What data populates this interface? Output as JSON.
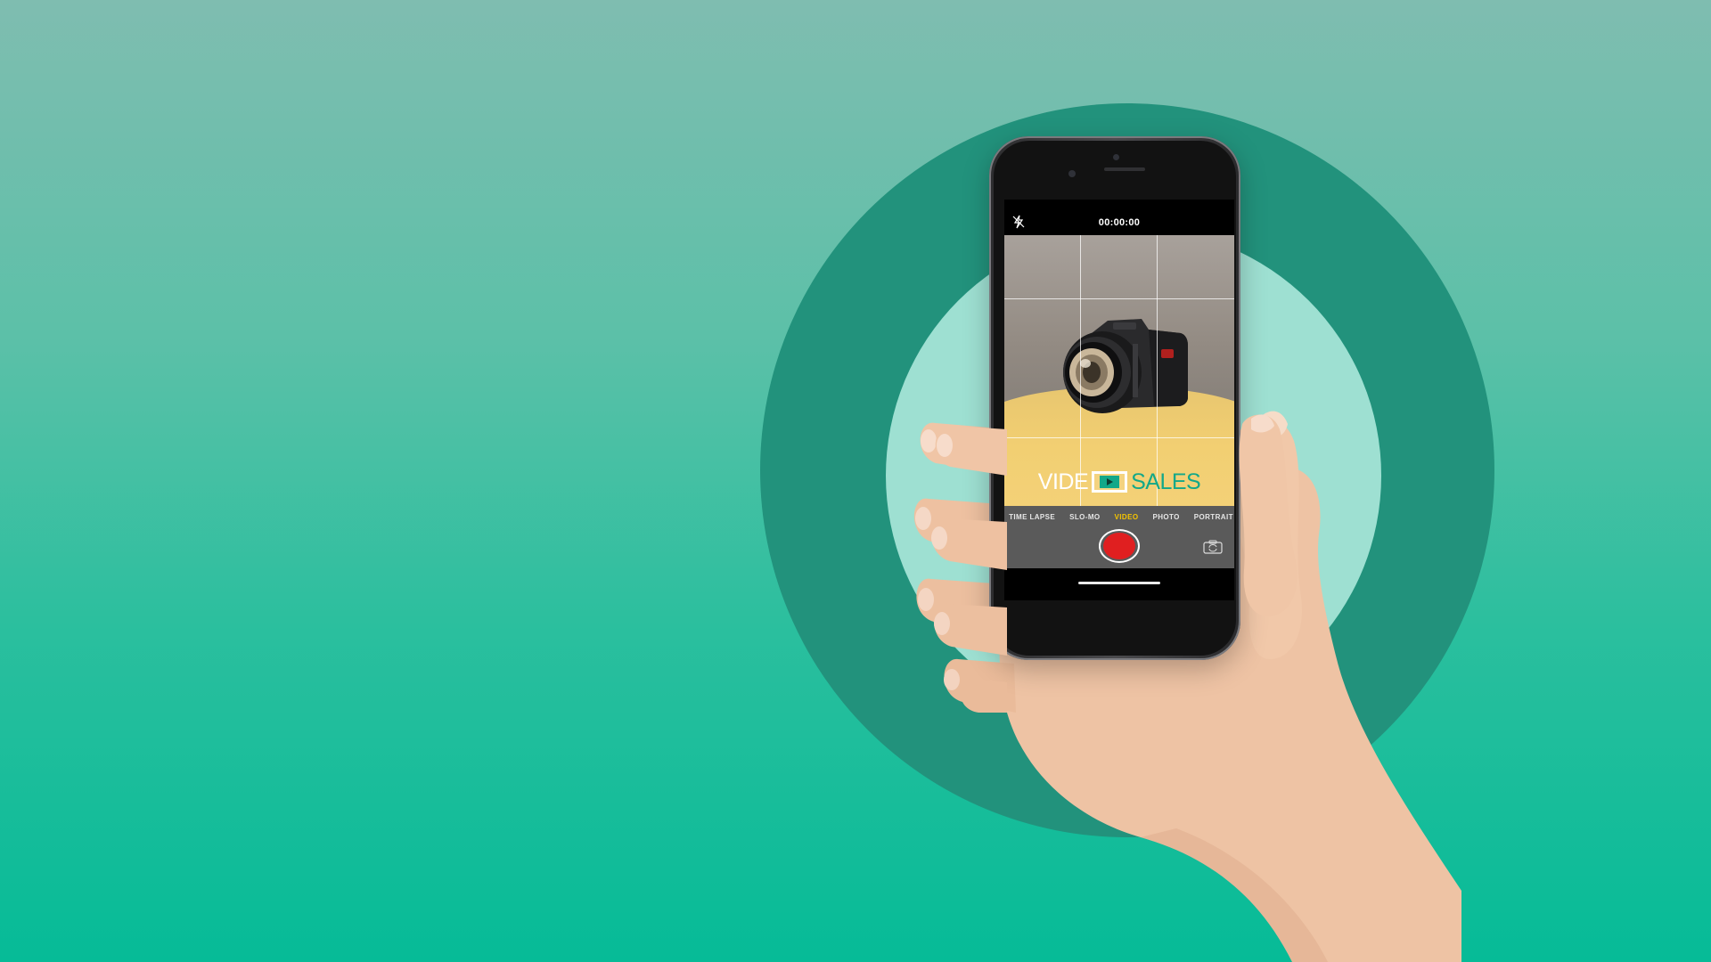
{
  "camera_app": {
    "timer": "00:00:00",
    "modes": [
      "TIME LAPSE",
      "SLO-MO",
      "VIDEO",
      "PHOTO",
      "PORTRAIT"
    ],
    "active_mode": "VIDEO",
    "logo": {
      "left": "VIDE",
      "right": "SALES"
    },
    "icons": {
      "flash": "flash-off-icon",
      "flip": "camera-flip-icon",
      "record": "record-icon",
      "play": "play-icon"
    }
  },
  "colors": {
    "background_top": "#7fbdb0",
    "background_bottom": "#06bb97",
    "ring_outer": "#22927c",
    "ring_inner": "#9ee0d2",
    "record": "#e01f20",
    "active_mode": "#f5c400",
    "logo_accent": "#13a889"
  }
}
